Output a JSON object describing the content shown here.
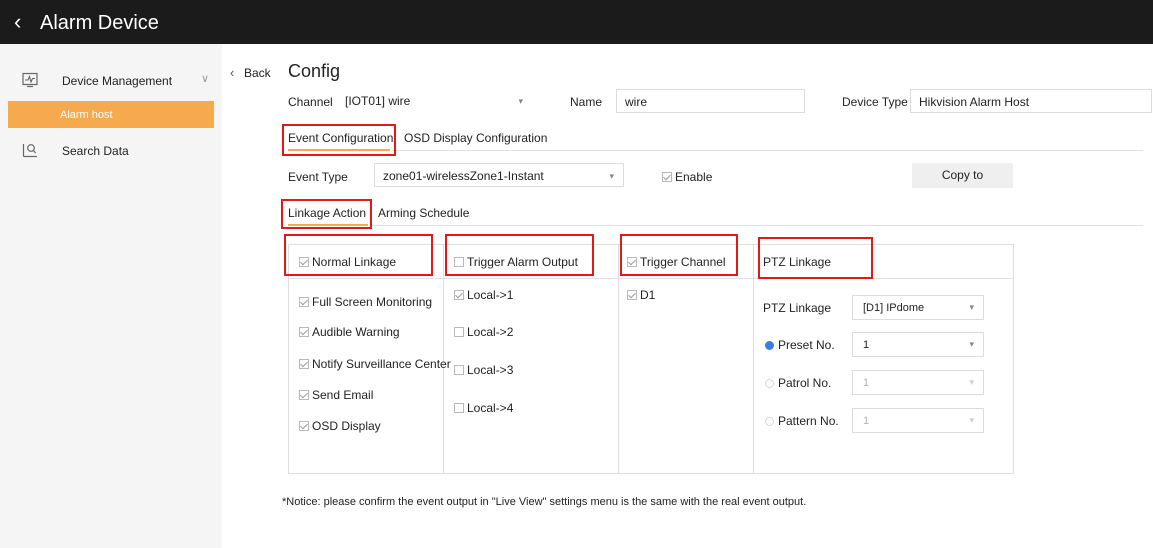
{
  "topbar": {
    "back_icon": "chevron-left-icon",
    "title": "Alarm Device"
  },
  "sidebar": {
    "items": [
      {
        "icon": "device-management-icon",
        "label": "Device Management",
        "expand_icon": "chevron-down-icon"
      },
      {
        "icon": "search-data-icon",
        "label": "Search Data"
      }
    ],
    "sub_item": {
      "label": "Alarm host",
      "selected": true
    }
  },
  "colors": {
    "accent": "#f7a94d",
    "highlight_box": "#e01a1a",
    "radio_selected": "#3d7ce0"
  },
  "header": {
    "back_label": "Back",
    "title": "Config"
  },
  "fields": {
    "channel_label": "Channel",
    "channel_value": "[IOT01] wire",
    "name_label": "Name",
    "name_value": "wire",
    "device_type_label": "Device Type",
    "device_type_value": "Hikvision Alarm Host"
  },
  "tabs": [
    "Event Configuration",
    "OSD Display Configuration"
  ],
  "event": {
    "type_label": "Event Type",
    "type_value": "zone01-wirelessZone1-Instant",
    "enable_label": "Enable",
    "enable_checked": true,
    "copy_label": "Copy to"
  },
  "subtabs": [
    "Linkage Action",
    "Arming Schedule"
  ],
  "linkage": {
    "normal": {
      "header": "Normal Linkage",
      "items": [
        "Full Screen Monitoring",
        "Audible Warning",
        "Notify Surveillance Center",
        "Send Email",
        "OSD Display"
      ]
    },
    "alarm_output": {
      "header": "Trigger Alarm Output",
      "items": [
        "Local->1",
        "Local->2",
        "Local->3",
        "Local->4"
      ]
    },
    "channel": {
      "header": "Trigger Channel",
      "items": [
        "D1"
      ]
    },
    "ptz": {
      "header": "PTZ Linkage",
      "ptz_label": "PTZ Linkage",
      "ptz_value": "[D1] IPdome",
      "preset_label": "Preset No.",
      "preset_value": "1",
      "patrol_label": "Patrol No.",
      "patrol_value": "1",
      "pattern_label": "Pattern No.",
      "pattern_value": "1"
    }
  },
  "notice": "*Notice: please confirm the event output in \"Live View\" settings menu is the same with the real event output."
}
